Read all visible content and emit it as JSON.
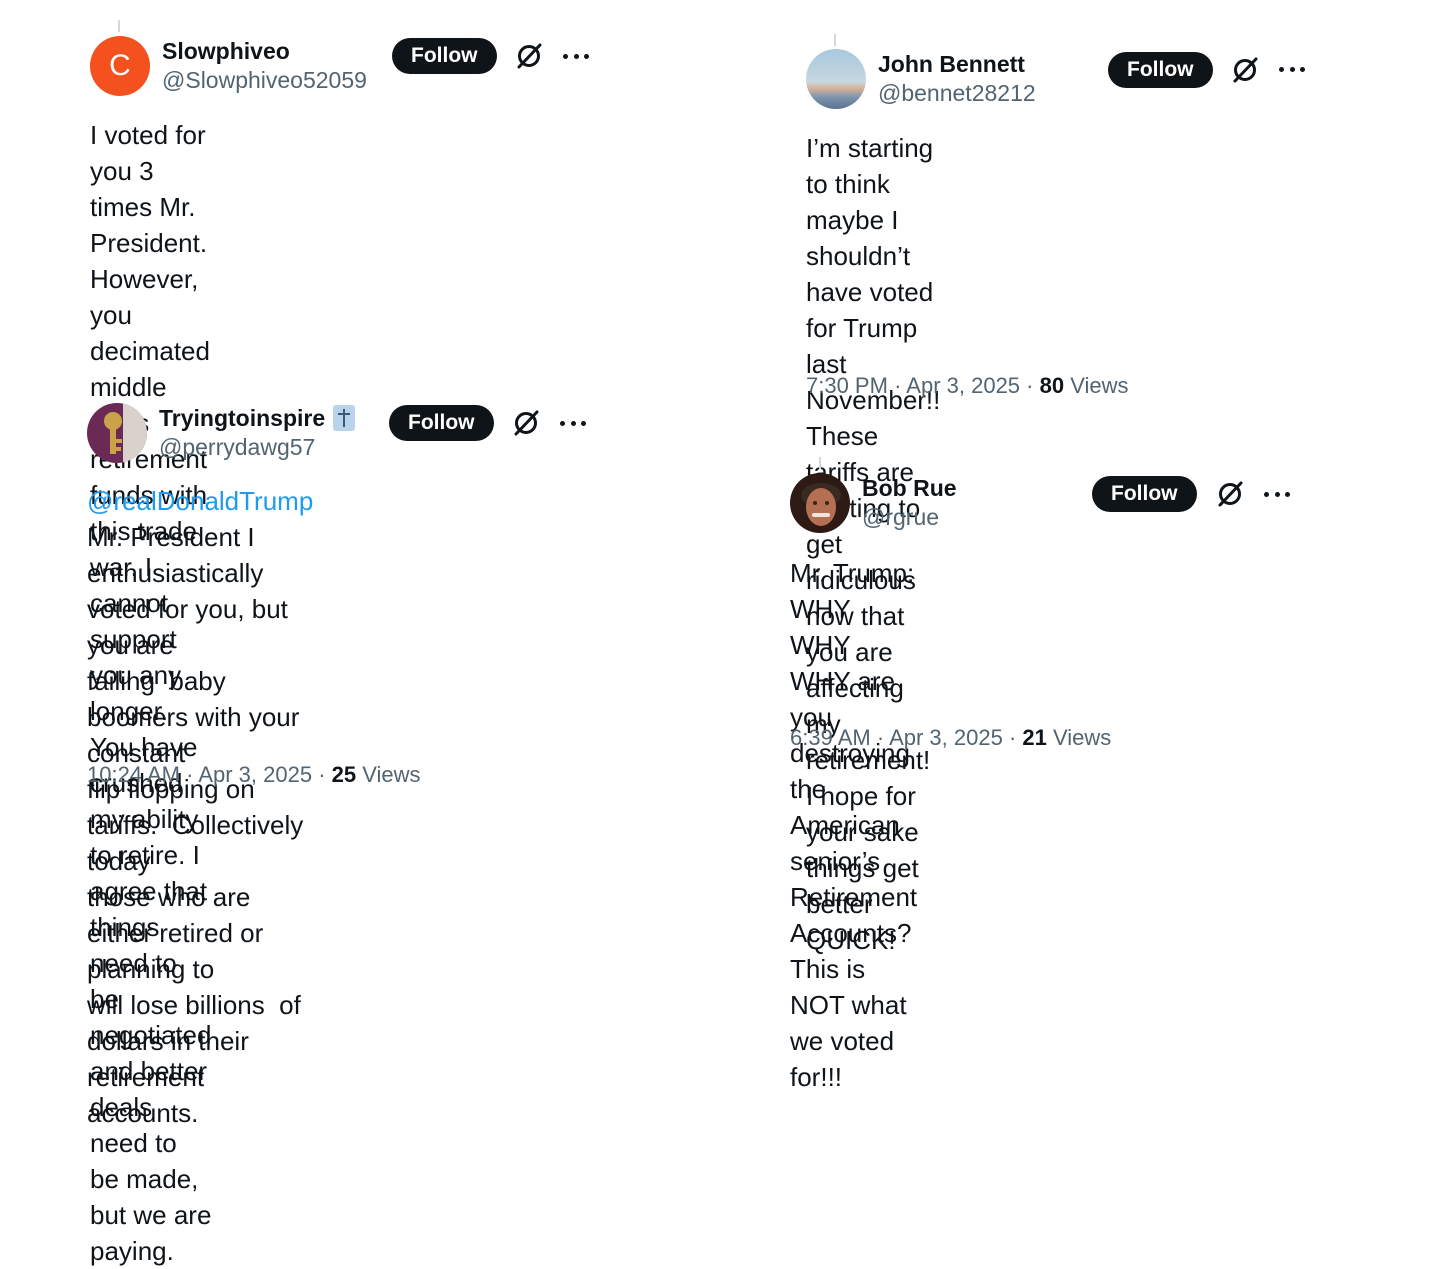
{
  "posts": [
    {
      "display_name": "Slowphiveo",
      "handle": "@Slowphiveo52059",
      "avatar_letter": "C",
      "follow_label": "Follow",
      "text": "I voted for you 3 times Mr. President.\nHowever, you decimated middle class\nretirement funds with this trade war. I\ncannot support you any longer. You have\ncrushed my ability to retire. I agree that\nthings need to be negotiated and better\ndeals need to be made, but we are paying."
    },
    {
      "display_name": "Tryingtoinspire",
      "handle": "@perrydawg57",
      "follow_label": "Follow",
      "mention": "@realDonaldTrump",
      "text": " Mr. President I\nenthusiastically voted for you, but you are\nfailing  baby boomers with your constant\nflip flopping on tariffs.  Collectively today\nthose who are either retired or planning to\nwill lose billions  of dollars in their\nretirement accounts.",
      "time": "10:24 AM",
      "date": "Apr 3, 2025",
      "views_count": "25",
      "views_label": "Views"
    },
    {
      "display_name": "John Bennett",
      "handle": "@bennet28212",
      "follow_label": "Follow",
      "text": "I’m starting to think maybe I shouldn’t\nhave voted for Trump last November!!\nThese tariffs are starting to get ridiculous\nnow that you are affecting my retirement!\nI hope for your sake things get better\nQUICK!",
      "time": "7:30 PM",
      "date": "Apr 3, 2025",
      "views_count": "80",
      "views_label": "Views"
    },
    {
      "display_name": "Bob Rue",
      "handle": "@rgrue",
      "follow_label": "Follow",
      "text": "Mr. Trump:   WHY WHY WHY are you\ndestroying the American senior’s\nRetirement Accounts?     This is NOT what\nwe voted for!!!",
      "time": "6:39 AM",
      "date": "Apr 3, 2025",
      "views_count": "21",
      "views_label": "Views"
    }
  ],
  "meta_separator": "·",
  "colors": {
    "text": "#0f1419",
    "secondary": "#536471",
    "link": "#1d9bf0",
    "follow_bg": "#0f1419",
    "avatar_c": "#f4511e"
  },
  "icons": [
    "grok-icon",
    "more-icon"
  ]
}
